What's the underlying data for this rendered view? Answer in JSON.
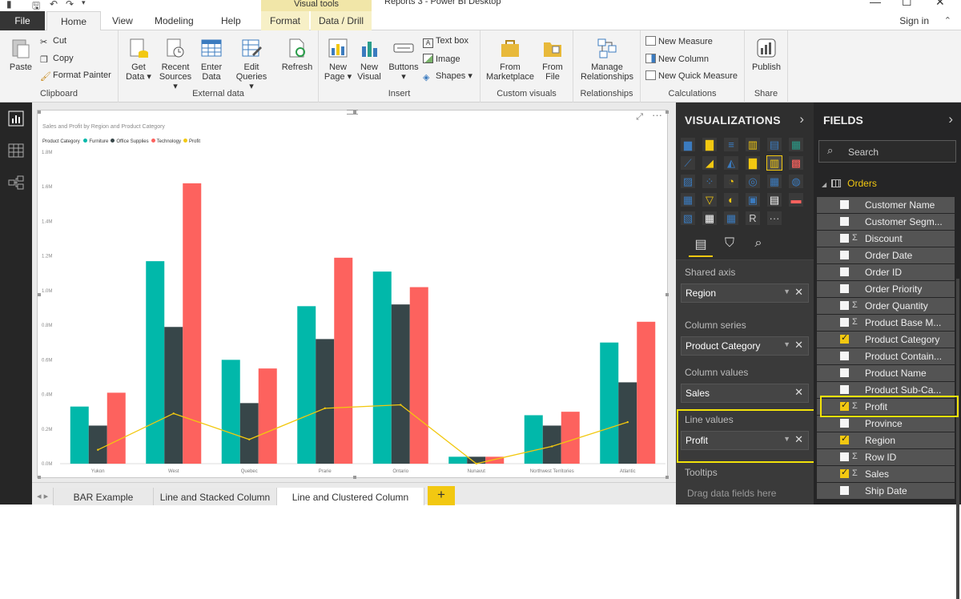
{
  "window": {
    "title": "Reports 3 - Power BI Desktop",
    "visual_tools": "Visual tools"
  },
  "menu": {
    "file": "File",
    "tabs": [
      "Home",
      "View",
      "Modeling",
      "Help",
      "Format",
      "Data / Drill"
    ],
    "sign_in": "Sign in"
  },
  "ribbon": {
    "clipboard": {
      "label": "Clipboard",
      "paste": "Paste",
      "cut": "Cut",
      "copy": "Copy",
      "format_painter": "Format Painter"
    },
    "external_data": {
      "label": "External data",
      "get_data": [
        "Get",
        "Data ▾"
      ],
      "recent_sources": [
        "Recent",
        "Sources ▾"
      ],
      "enter_data": [
        "Enter",
        "Data"
      ],
      "edit_queries": [
        "Edit",
        "Queries ▾"
      ],
      "refresh": "Refresh"
    },
    "insert": {
      "label": "Insert",
      "new_page": [
        "New",
        "Page ▾"
      ],
      "new_visual": [
        "New",
        "Visual"
      ],
      "buttons": [
        "Buttons",
        "▾"
      ],
      "text_box": "Text box",
      "image": "Image",
      "shapes": "Shapes ▾"
    },
    "custom_visuals": {
      "label": "Custom visuals",
      "from_marketplace": [
        "From",
        "Marketplace"
      ],
      "from_file": [
        "From",
        "File"
      ]
    },
    "relationships": {
      "label": "Relationships",
      "manage": [
        "Manage",
        "Relationships"
      ]
    },
    "calculations": {
      "label": "Calculations",
      "new_measure": "New Measure",
      "new_column": "New Column",
      "new_quick_measure": "New Quick Measure"
    },
    "share": {
      "label": "Share",
      "publish": "Publish"
    }
  },
  "visual": {
    "title": "Sales and Profit by Region and Product Category",
    "legend_title": "Product Category",
    "focus_icon": "focus-mode-icon",
    "more_icon": "more-options-icon"
  },
  "chart_data": {
    "type": "bar",
    "combo": "line and clustered column",
    "title": "Sales and Profit by Region and Product Category",
    "categories": [
      "Yukon",
      "West",
      "Quebec",
      "Prarie",
      "Ontario",
      "Nunavut",
      "Northwest Territories",
      "Atlantic"
    ],
    "y_ticks": [
      "0.0M",
      "0.2M",
      "0.4M",
      "0.6M",
      "0.8M",
      "1.0M",
      "1.2M",
      "1.4M",
      "1.6M",
      "1.8M"
    ],
    "ylim": [
      0,
      1.8
    ],
    "y_unit": "M",
    "grid": false,
    "legend_position": "top-left",
    "series": [
      {
        "name": "Furniture",
        "type": "column",
        "color": "#01b8aa",
        "values": [
          0.33,
          1.17,
          0.6,
          0.91,
          1.11,
          0.04,
          0.28,
          0.7
        ]
      },
      {
        "name": "Office Supplies",
        "type": "column",
        "color": "#374649",
        "values": [
          0.22,
          0.79,
          0.35,
          0.72,
          0.92,
          0.04,
          0.22,
          0.47
        ]
      },
      {
        "name": "Technology",
        "type": "column",
        "color": "#fd625e",
        "values": [
          0.41,
          1.62,
          0.55,
          1.19,
          1.02,
          0.04,
          0.3,
          0.82
        ]
      },
      {
        "name": "Profit",
        "type": "line",
        "color": "#f2c80f",
        "values": [
          0.08,
          0.29,
          0.14,
          0.32,
          0.34,
          0.0,
          0.1,
          0.24
        ]
      }
    ]
  },
  "pages": {
    "tabs": [
      "BAR Example",
      "Line and Stacked Column",
      "Line and Clustered Column"
    ],
    "add": "+"
  },
  "visualizations": {
    "header": "VISUALIZATIONS",
    "arrow": "›",
    "wells": [
      {
        "label": "Shared axis",
        "value": "Region"
      },
      {
        "label": "Column series",
        "value": "Product Category"
      },
      {
        "label": "Column values",
        "value": "Sales"
      },
      {
        "label": "Line values",
        "value": "Profit"
      }
    ],
    "tooltips_label": "Tooltips",
    "drag_hint": "Drag data fields here"
  },
  "fields": {
    "header": "FIELDS",
    "arrow": "›",
    "search_placeholder": "Search",
    "table": "Orders",
    "items": [
      {
        "name": "Customer Name",
        "sigma": "",
        "checked": false
      },
      {
        "name": "Customer Segm...",
        "sigma": "",
        "checked": false
      },
      {
        "name": "Discount",
        "sigma": "Σ",
        "checked": false
      },
      {
        "name": "Order Date",
        "sigma": "",
        "checked": false
      },
      {
        "name": "Order ID",
        "sigma": "",
        "checked": false
      },
      {
        "name": "Order Priority",
        "sigma": "",
        "checked": false
      },
      {
        "name": "Order Quantity",
        "sigma": "Σ",
        "checked": false
      },
      {
        "name": "Product Base M...",
        "sigma": "Σ",
        "checked": false
      },
      {
        "name": "Product Category",
        "sigma": "",
        "checked": true
      },
      {
        "name": "Product Contain...",
        "sigma": "",
        "checked": false
      },
      {
        "name": "Product Name",
        "sigma": "",
        "checked": false
      },
      {
        "name": "Product Sub-Ca...",
        "sigma": "",
        "checked": false
      },
      {
        "name": "Profit",
        "sigma": "Σ",
        "checked": true
      },
      {
        "name": "Province",
        "sigma": "",
        "checked": false
      },
      {
        "name": "Region",
        "sigma": "",
        "checked": true
      },
      {
        "name": "Row ID",
        "sigma": "Σ",
        "checked": false
      },
      {
        "name": "Sales",
        "sigma": "Σ",
        "checked": true
      },
      {
        "name": "Ship Date",
        "sigma": "",
        "checked": false
      }
    ]
  }
}
